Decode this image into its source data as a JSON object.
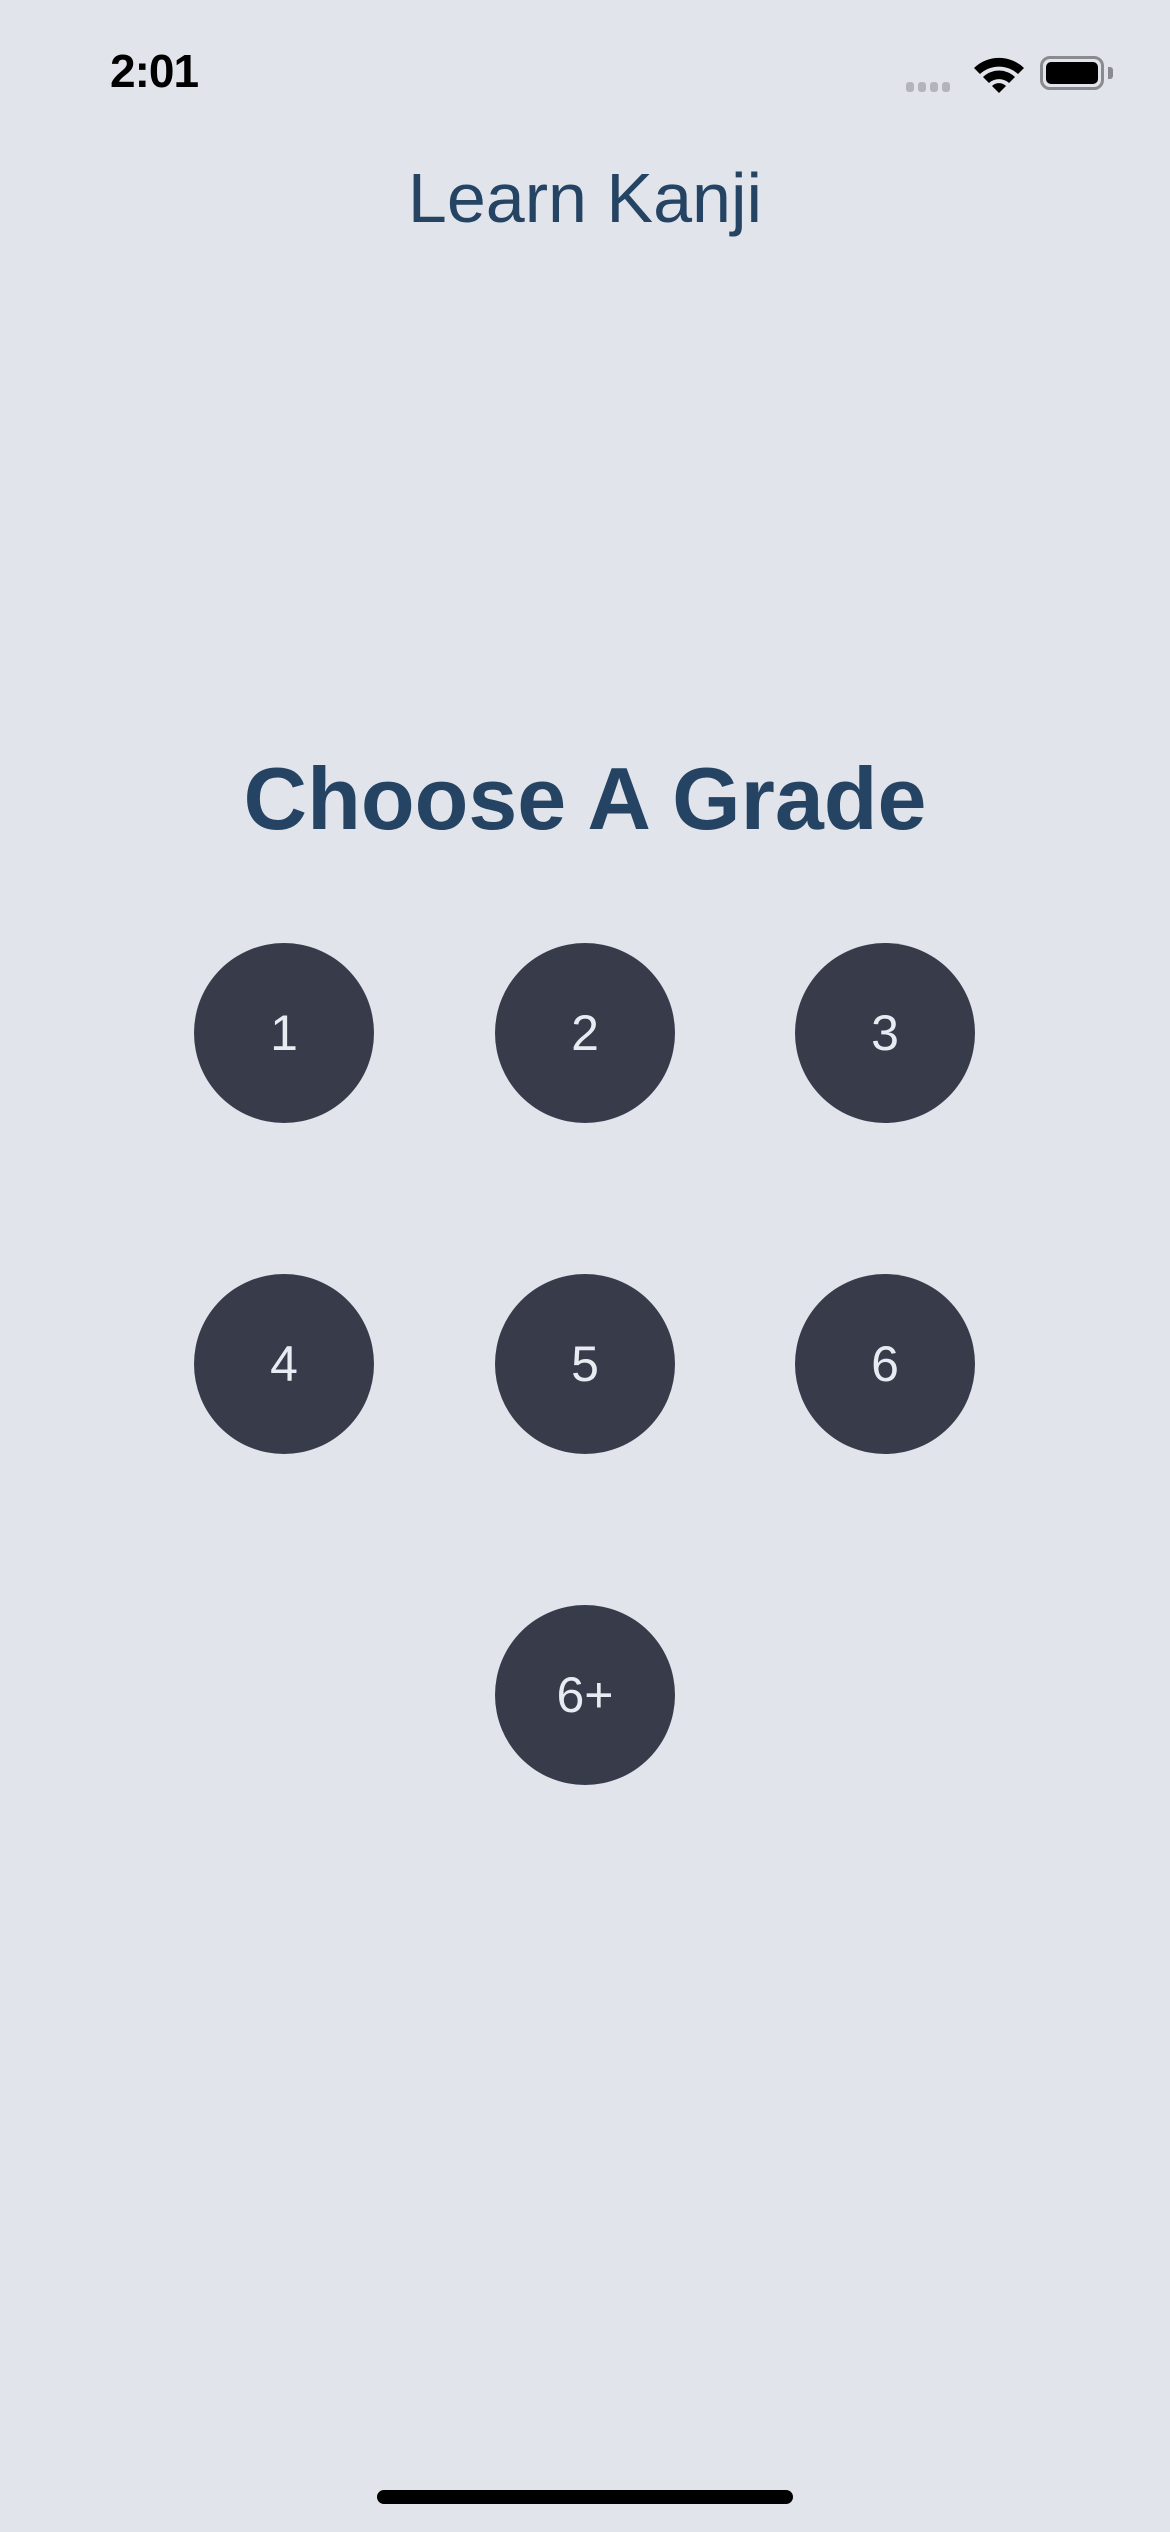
{
  "status_bar": {
    "time": "2:01",
    "icons": [
      "cellular-signal-icon",
      "wifi-icon",
      "battery-icon"
    ]
  },
  "header": {
    "title": "Learn Kanji"
  },
  "main": {
    "heading": "Choose A Grade",
    "grades": [
      {
        "label": "1"
      },
      {
        "label": "2"
      },
      {
        "label": "3"
      },
      {
        "label": "4"
      },
      {
        "label": "5"
      },
      {
        "label": "6"
      },
      {
        "label": "6+"
      }
    ]
  },
  "colors": {
    "background": "#e1e4eb",
    "title": "#254463",
    "button": "#373b4a",
    "button_text": "#e8ebf2"
  }
}
